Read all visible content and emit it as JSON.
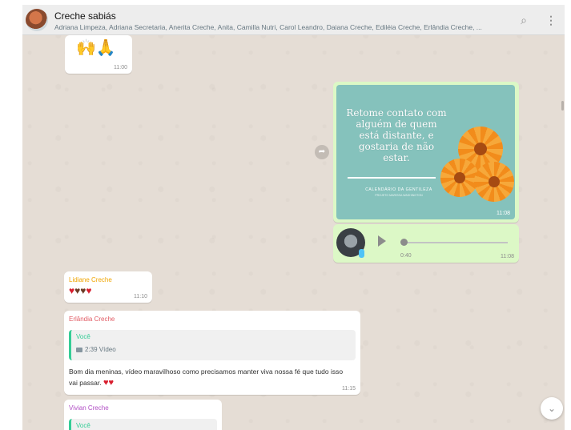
{
  "header": {
    "title": "Creche sabiás",
    "members": "Adriana Limpeza, Adriana Secretaria, Anerita Creche, Anita, Camilla Nutri, Carol Leandro, Daiana Creche, Ediléia Creche, Erlândia Creche, ...",
    "icons": [
      "search-icon",
      "menu-icon"
    ]
  },
  "messages": {
    "sticker": {
      "emoji": "🙌🙏",
      "time": "11:00"
    },
    "image": {
      "quote_text": "Retome contato com alguém de quem está distante, e gostaria de não estar.",
      "caption": "CALENDÁRIO DA GENTILEZA",
      "caption_sub": "PROJETO MARISSA WASHINGTON",
      "time": "11:08"
    },
    "audio": {
      "duration": "0:40",
      "time": "11:08"
    },
    "lidiane": {
      "sender": "Lidiane Creche",
      "time": "11:10"
    },
    "erlandia": {
      "sender": "Erlândia Creche",
      "quote_author": "Você",
      "quote_video": "2:39 Vídeo",
      "text": "Bom dia meninas, vídeo maravilhoso como precisamos manter viva nossa fé que tudo isso vai passar.",
      "time": "11:15"
    },
    "vivian": {
      "sender": "Vivian Creche",
      "quote_author": "Você"
    }
  },
  "colors": {
    "chat_bg": "#e5ddd5",
    "outgoing": "#dcf8c6",
    "lidiane_name": "#f0a500",
    "erlandia_name": "#e15b64",
    "vivian_name": "#b14fc5",
    "quote_bar": "#35cd96"
  }
}
